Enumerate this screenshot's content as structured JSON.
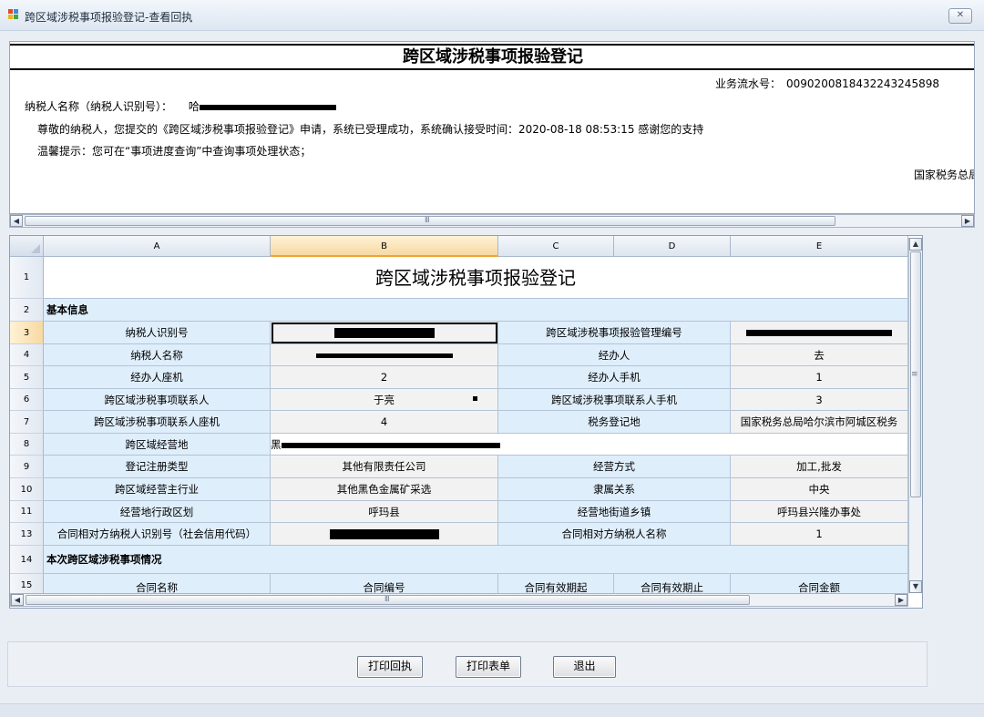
{
  "window": {
    "title": "跨区域涉税事项报验登记-查看回执",
    "close_label": "✕"
  },
  "receipt": {
    "title": "跨区域涉税事项报验登记",
    "serial_label": "业务流水号：",
    "serial_value": "00902008184322432458​98",
    "taxpayer_label": "纳税人名称（纳税人识别号）：",
    "taxpayer_prefix": "哈",
    "notice": "尊敬的纳税人，您提交的《跨区域涉税事项报验登记》申请，系统已受理成功，系统确认接受时间：2020-08-18  08:53:15  感谢您的支持",
    "tip": "温馨提示：您可在“事项进度查询”中查询事项处理状态；",
    "bureau": "国家税务总局"
  },
  "sheet": {
    "columns": [
      "A",
      "B",
      "C",
      "D",
      "E"
    ],
    "row_numbers": [
      "1",
      "2",
      "3",
      "4",
      "5",
      "6",
      "7",
      "8",
      "9",
      "10",
      "11",
      "13",
      "14",
      "15"
    ],
    "form_title": "跨区域涉税事项报验登记",
    "section_basic": "基本信息",
    "section_current": "本次跨区域涉税事项情况",
    "r3": {
      "a": "纳税人识别号",
      "c": "跨区域涉税事项报验管理编号"
    },
    "r4": {
      "a": "纳税人名称",
      "c": "经办人",
      "e": "去"
    },
    "r5": {
      "a": "经办人座机",
      "b": "2",
      "c": "经办人手机",
      "e": "1"
    },
    "r6": {
      "a": "跨区域涉税事项联系人",
      "b": "于亮",
      "c": "跨区域涉税事项联系人手机",
      "e": "3"
    },
    "r7": {
      "a": "跨区域涉税事项联系人座机",
      "b": "4",
      "c": "税务登记地",
      "e": "国家税务总局哈尔滨市阿城区税务"
    },
    "r8": {
      "a": "跨区域经营地",
      "b": "黑"
    },
    "r9": {
      "a": "登记注册类型",
      "b": "其他有限责任公司",
      "c": "经营方式",
      "e": "加工,批发"
    },
    "r10": {
      "a": "跨区域经营主行业",
      "b": "其他黑色金属矿采选",
      "c": "隶属关系",
      "e": "中央"
    },
    "r11": {
      "a": "经营地行政区划",
      "b": "呼玛县",
      "c": "经营地街道乡镇",
      "e": "呼玛县兴隆办事处"
    },
    "r13": {
      "a": "合同相对方纳税人识别号（社会信用代码）",
      "c": "合同相对方纳税人名称",
      "e": "1"
    },
    "r15": {
      "a": "合同名称",
      "b": "合同编号",
      "c": "合同有效期起",
      "d": "合同有效期止",
      "e": "合同金额"
    }
  },
  "buttons": {
    "print_receipt": "打印回执",
    "print_form": "打印表单",
    "exit": "退出"
  },
  "icons": {
    "scroll_left": "◀",
    "scroll_right": "▶",
    "scroll_up": "▲",
    "scroll_down": "▼",
    "grip_h": "Ⅲ",
    "grip_v": "≡"
  }
}
